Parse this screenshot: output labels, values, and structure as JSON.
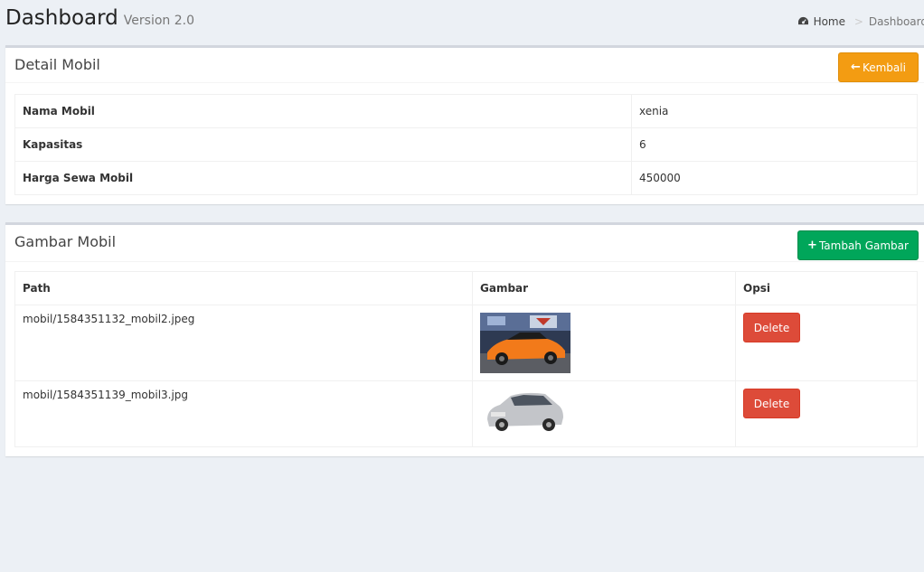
{
  "header": {
    "title": "Dashboard",
    "subtitle": "Version 2.0",
    "breadcrumb": {
      "home": "Home",
      "current": "Dashboard"
    }
  },
  "detail_box": {
    "title": "Detail Mobil",
    "back_button": "Kembali",
    "rows": [
      {
        "key": "Nama Mobil",
        "value": "xenia"
      },
      {
        "key": "Kapasitas",
        "value": "6"
      },
      {
        "key": "Harga Sewa Mobil",
        "value": "450000"
      }
    ]
  },
  "image_box": {
    "title": "Gambar Mobil",
    "add_button": "Tambah Gambar",
    "columns": [
      "Path",
      "Gambar",
      "Opsi"
    ],
    "rows": [
      {
        "path": "mobil/1584351132_mobil2.jpeg",
        "delete_label": "Delete"
      },
      {
        "path": "mobil/1584351139_mobil3.jpg",
        "delete_label": "Delete"
      }
    ]
  },
  "colors": {
    "background": "#ecf0f5",
    "warning": "#f39c12",
    "success": "#00a65a",
    "danger": "#dd4b39"
  }
}
